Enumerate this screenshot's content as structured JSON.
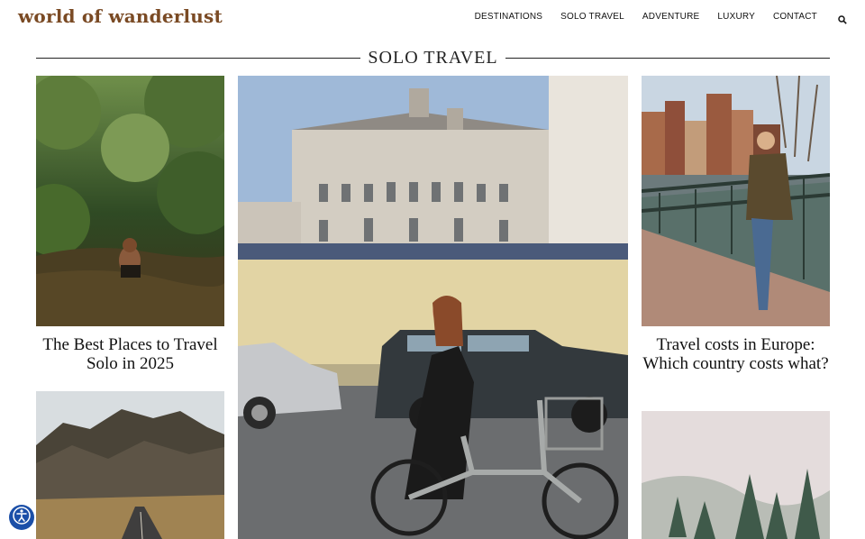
{
  "site": {
    "logo": "world of wanderlust"
  },
  "nav": {
    "items": [
      {
        "label": "DESTINATIONS"
      },
      {
        "label": "SOLO TRAVEL"
      },
      {
        "label": "ADVENTURE"
      },
      {
        "label": "LUXURY"
      },
      {
        "label": "CONTACT"
      }
    ],
    "search_icon": "search-icon"
  },
  "section": {
    "title": "SOLO TRAVEL"
  },
  "articles": [
    {
      "title": "The Best Places to Travel Solo in 2025",
      "image": "woman-in-jungle-river"
    },
    {
      "title": "",
      "image": "mountain-road-landscape"
    },
    {
      "title": "",
      "image": "woman-cycling-past-building"
    },
    {
      "title": "Travel costs in Europe: Which country costs what?",
      "image": "woman-on-amsterdam-bridge"
    },
    {
      "title": "",
      "image": "misty-pine-forest"
    }
  ],
  "a11y": {
    "icon": "accessibility-icon"
  },
  "colors": {
    "logo": "#7a4a24",
    "a11y_badge": "#1b4fa8"
  }
}
